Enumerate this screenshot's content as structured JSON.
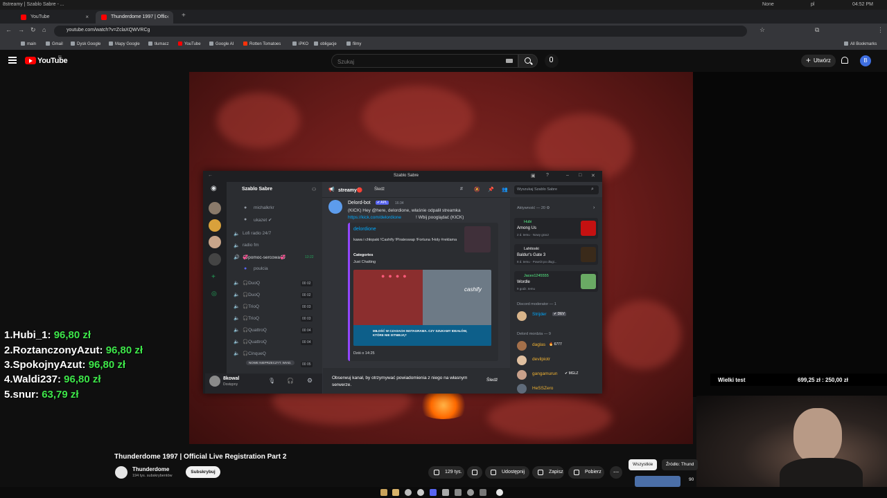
{
  "os_bar": {
    "workspace": "8streamy | Szablo Sabre - ...",
    "media": "None",
    "lang": "pl",
    "clock": "04:52 PM"
  },
  "browser": {
    "tabs": [
      {
        "title": "YouTube"
      },
      {
        "title": "Thunderdome 1997 | Official..."
      }
    ],
    "url": "youtube.com/watch?v=ZclaXQWVRCg",
    "bookmarks": [
      "main",
      "Gmail",
      "Dysk Google",
      "Mapy Google",
      "tłumacz",
      "YouTube",
      "Google AI",
      "Rotten Tomatoes",
      "iPKO",
      "obligacje",
      "filmy"
    ],
    "all_bookmarks": "All Bookmarks"
  },
  "youtube": {
    "logo": "YouTube",
    "region": "PL",
    "search_placeholder": "Szukaj",
    "create_label": "Utwórz",
    "avatar_letter": "B",
    "video_title": "Thunderdome 1997 | Official Live Registration Part 2",
    "channel_name": "Thunderdome",
    "channel_subs": "194 tys. subskrybentów",
    "subscribe_label": "Subskrybuj",
    "likes": "129 tys.",
    "share_label": "Udostępnij",
    "save_label": "Zapisz",
    "download_label": "Pobierz",
    "more_label": "...",
    "chips": [
      "Wszystkie",
      "Źródło: Thund"
    ],
    "rec_count": "90"
  },
  "discord": {
    "window_title": "Szablo Sabre",
    "server_name": "Szablo Sabre",
    "channels": [
      {
        "name": "michalkrkr",
        "count": "",
        "kind": "user"
      },
      {
        "name": "ukazet ✔",
        "count": "",
        "kind": "user"
      },
      {
        "name": "Lofi radio 24/7",
        "count": "",
        "kind": "voice"
      },
      {
        "name": "radio fm",
        "count": "",
        "kind": "voice"
      },
      {
        "name": "💞pomoc-sercowa💞",
        "count": "13:22",
        "kind": "voice"
      },
      {
        "name": "poulcia",
        "count": "",
        "kind": "user"
      },
      {
        "name": "🎧DuoQ",
        "count": "00 02",
        "kind": "voice"
      },
      {
        "name": "🎧DuoQ",
        "count": "00 02",
        "kind": "voice"
      },
      {
        "name": "🎧TrioQ",
        "count": "00 03",
        "kind": "voice"
      },
      {
        "name": "🎧TrioQ",
        "count": "00 03",
        "kind": "voice"
      },
      {
        "name": "🎧QuattroQ",
        "count": "00 04",
        "kind": "voice"
      },
      {
        "name": "🎧QuattroQ",
        "count": "00 04",
        "kind": "voice"
      },
      {
        "name": "🎧CinqueQ",
        "count": "00 05",
        "kind": "voice"
      }
    ],
    "new_unread": "NOWE NIEPRZECZYT. WIAD.",
    "user_name": "8kowal",
    "user_status": "Dostępny",
    "channel_title": "streamy🔴",
    "follow_tab": "Śledź",
    "search_placeholder": "Wyszukaj Szablo Sabre",
    "message": {
      "author": "Delord-bot",
      "app_tag": "✔ APL",
      "time": "16:34",
      "text": "(KICK) Hey @here, delordione, właśnie odpalił streamka",
      "link": "https://kick.com/delordione",
      "text2": "! Wbij pooglądać (KICK)",
      "embed_title": "delordione",
      "embed_desc": "kawa i chłopaki !Cashify !Pirateswap !Fortuna !Holy #reklama",
      "embed_cat_label": "Categories",
      "embed_cat_value": "Just Chatting",
      "embed_footer": "Dziś o 14:25",
      "embed_banner": "MIŁOŚĆ W CZASACH INSTAGRAMA. CZY SZUKAMY IDEAŁÓW, KTÓRE NIE ISTNIEJĄ?",
      "embed_brand": "cashify"
    },
    "follow_bar_text": "Obserwuj kanał, by otrzymywać powiadomienia z niego na własnym serwerze.",
    "follow_bar_button": "Śledź",
    "activity_title": "Aktywność — 20 ⚙",
    "activities": [
      {
        "user": "Hubi",
        "game": "Among Us",
        "meta": "2 d. temu · Nowy gracz",
        "user_color": "#57f287"
      },
      {
        "user": "Lahitoski",
        "game": "Baldur's Gate 3",
        "meta": "8 d. temu · Powrót po długi...",
        "user_color": "#ffffff"
      },
      {
        "user": "Jacex1245555",
        "game": "Wordle",
        "meta": "9 godz. temu",
        "user_color": "#57f287"
      }
    ],
    "groups": [
      {
        "title": "Discord moderator — 1",
        "members": [
          {
            "name": "Strijder",
            "tag": "✔ DEV",
            "color": "#00a8fc"
          }
        ]
      },
      {
        "title": "Delord mordzia — 9",
        "members": [
          {
            "name": "daglas",
            "tag": "🔥 6777",
            "color": "#f0b232"
          },
          {
            "name": "devilpiotr",
            "tag": "",
            "color": "#f0b232"
          },
          {
            "name": "gangamurun",
            "tag": "✔ MGLZ",
            "color": "#f0b232"
          },
          {
            "name": "HeSSZero",
            "tag": "",
            "color": "#f0b232"
          }
        ]
      }
    ]
  },
  "leaderboard": [
    {
      "rank": "1.",
      "name": "Hubi_1:",
      "amount": "96,80 zł"
    },
    {
      "rank": "2.",
      "name": "RoztanczonyAzut:",
      "amount": "96,80 zł"
    },
    {
      "rank": "3.",
      "name": "SpokojnyAzut:",
      "amount": "96,80 zł"
    },
    {
      "rank": "4.",
      "name": "Waldi237:",
      "amount": "96,80 zł"
    },
    {
      "rank": "5.",
      "name": "snur:",
      "amount": "63,79 zł"
    }
  ],
  "goal": {
    "label": "Wielki test",
    "value": "699,25 zł : 250,00 zł"
  },
  "colors": {
    "yt_red": "#ff0000",
    "discord_bg": "#313338",
    "leader_amount": "#3ee64a"
  }
}
